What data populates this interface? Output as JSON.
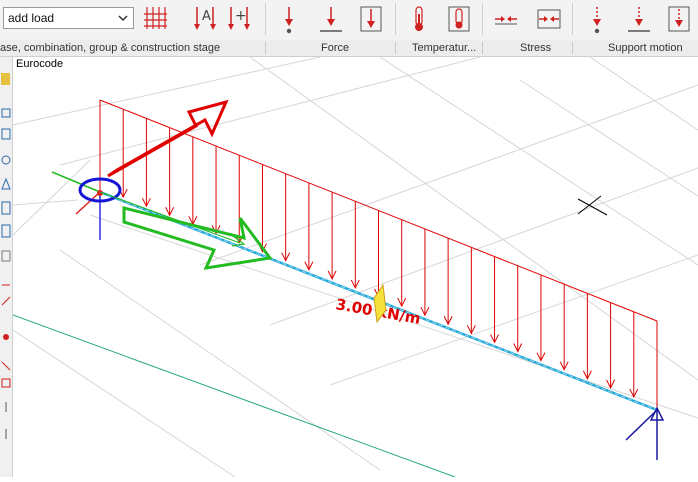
{
  "toolbar": {
    "load_select": "add load",
    "groups": {
      "case": "ase, combination, group  & construction stage",
      "force": "Force",
      "temperature": "Temperatur...",
      "stress": "Stress",
      "support": "Support motion"
    }
  },
  "viewport": {
    "code_label": "Eurocode",
    "load_label": "3.00 kN/m"
  },
  "colors": {
    "load": "#e00000",
    "beam": "#22a8d8",
    "support": "#1a1aa0",
    "axis_x": "#22bb22",
    "axis_y": "#ee2222",
    "axis_z": "#2222ee"
  }
}
